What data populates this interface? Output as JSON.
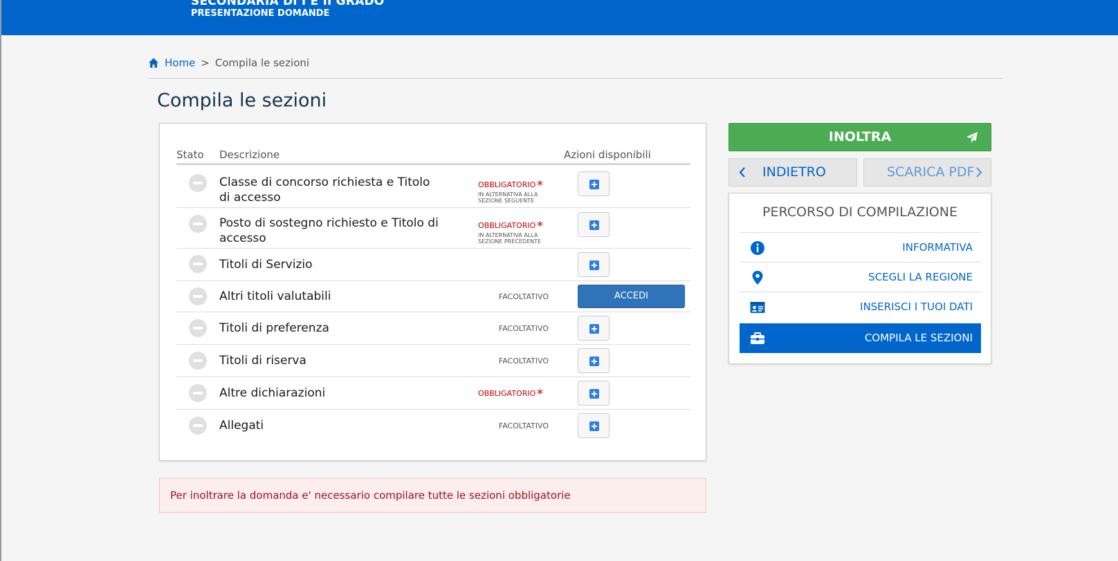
{
  "header": {
    "line1": "SECONDARIA DI I E II GRADO",
    "line2": "PRESENTAZIONE DOMANDE"
  },
  "breadcrumb": {
    "home": "Home",
    "separator": ">",
    "current": "Compila le sezioni"
  },
  "page_title": "Compila le sezioni",
  "table": {
    "headers": {
      "stato": "Stato",
      "descrizione": "Descrizione",
      "azioni": "Azioni disponibili"
    },
    "rows": [
      {
        "description": "Classe di concorso richiesta e Titolo di accesso",
        "tag": "OBBLIGATORIO",
        "note1": "IN ALTERNATIVA ALLA",
        "note2": "SEZIONE SEGUENTE"
      },
      {
        "description": "Posto di sostegno richiesto e Titolo di accesso",
        "tag": "OBBLIGATORIO",
        "note1": "IN ALTERNATIVA ALLA",
        "note2": "SEZIONE PRECEDENTE"
      },
      {
        "description": "Titoli di Servizio",
        "tag": ""
      },
      {
        "description": "Altri titoli valutabili",
        "tag": "FACOLTATIVO",
        "action": "ACCEDI"
      },
      {
        "description": "Titoli di preferenza",
        "tag": "FACOLTATIVO"
      },
      {
        "description": "Titoli di riserva",
        "tag": "FACOLTATIVO"
      },
      {
        "description": "Altre dichiarazioni",
        "tag": "OBBLIGATORIO"
      },
      {
        "description": "Allegati",
        "tag": "FACOLTATIVO"
      }
    ],
    "required_mark": "*"
  },
  "alert": "Per inoltrare la domanda e' necessario compilare tutte le sezioni obbligatorie",
  "actions": {
    "inoltra": "INOLTRA",
    "indietro": "INDIETRO",
    "scarica_pdf": "SCARICA PDF"
  },
  "percorso": {
    "title": "PERCORSO DI COMPILAZIONE",
    "items": [
      {
        "label": "INFORMATIVA",
        "icon": "info-icon"
      },
      {
        "label": "SCEGLI LA REGIONE",
        "icon": "map-pin-icon"
      },
      {
        "label": "INSERISCI I TUOI DATI",
        "icon": "id-card-icon"
      },
      {
        "label": "COMPILA LE SEZIONI",
        "icon": "briefcase-icon",
        "active": true
      }
    ]
  },
  "colors": {
    "primary": "#0066cc",
    "success": "#4cac53",
    "danger": "#c00000"
  }
}
